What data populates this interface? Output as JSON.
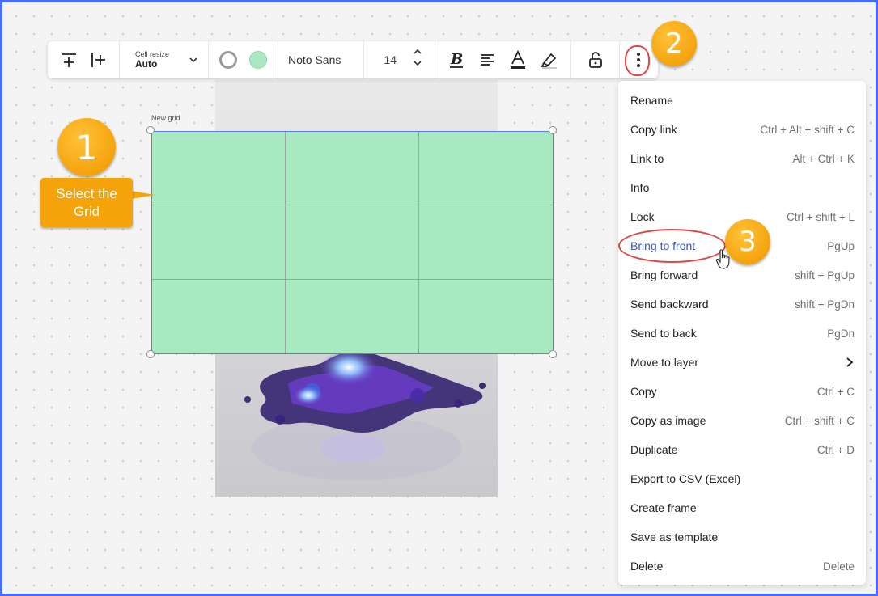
{
  "toolbar": {
    "cell_resize_label": "Cell resize",
    "cell_resize_value": "Auto",
    "font_name": "Noto Sans",
    "font_size": "14",
    "fill_color": "#a8e9c2"
  },
  "canvas": {
    "grid_label": "New grid",
    "grid_rows": 3,
    "grid_cols": 3
  },
  "callouts": {
    "step1_number": "1",
    "step1_text": "Select the Grid",
    "step2_number": "2",
    "step3_number": "3"
  },
  "menu": {
    "items": [
      {
        "label": "Rename",
        "shortcut": ""
      },
      {
        "label": "Copy link",
        "shortcut": "Ctrl + Alt + shift + C"
      },
      {
        "label": "Link to",
        "shortcut": "Alt + Ctrl + K"
      },
      {
        "label": "Info",
        "shortcut": ""
      },
      {
        "label": "Lock",
        "shortcut": "Ctrl + shift + L"
      },
      {
        "label": "Bring to front",
        "shortcut": "PgUp"
      },
      {
        "label": "Bring forward",
        "shortcut": "shift + PgUp"
      },
      {
        "label": "Send backward",
        "shortcut": "shift + PgDn"
      },
      {
        "label": "Send to back",
        "shortcut": "PgDn"
      },
      {
        "label": "Move to layer",
        "shortcut": ""
      },
      {
        "label": "Copy",
        "shortcut": "Ctrl + C"
      },
      {
        "label": "Copy as image",
        "shortcut": "Ctrl + shift + C"
      },
      {
        "label": "Duplicate",
        "shortcut": "Ctrl + D"
      },
      {
        "label": "Export to CSV (Excel)",
        "shortcut": ""
      },
      {
        "label": "Create frame",
        "shortcut": ""
      },
      {
        "label": "Save as template",
        "shortcut": ""
      },
      {
        "label": "Delete",
        "shortcut": "Delete"
      }
    ]
  }
}
